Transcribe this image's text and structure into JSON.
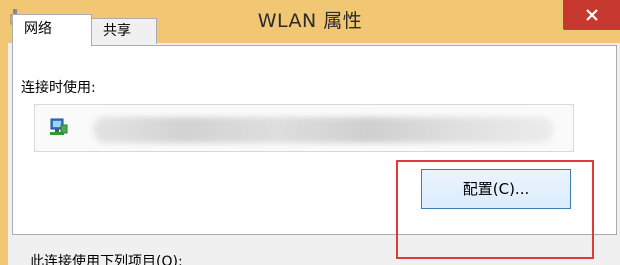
{
  "window": {
    "title": "WLAN 属性",
    "colors": {
      "frame": "#f1c774",
      "close": "#c7392f",
      "highlight": "#e03b3b"
    }
  },
  "tabs": [
    {
      "label": "网络",
      "selected": true
    },
    {
      "label": "共享",
      "selected": false
    }
  ],
  "network": {
    "connect_using_label": "连接时使用:",
    "configure_button": "配置(C)...",
    "items_label": "此连接使用下列项目(O):"
  }
}
